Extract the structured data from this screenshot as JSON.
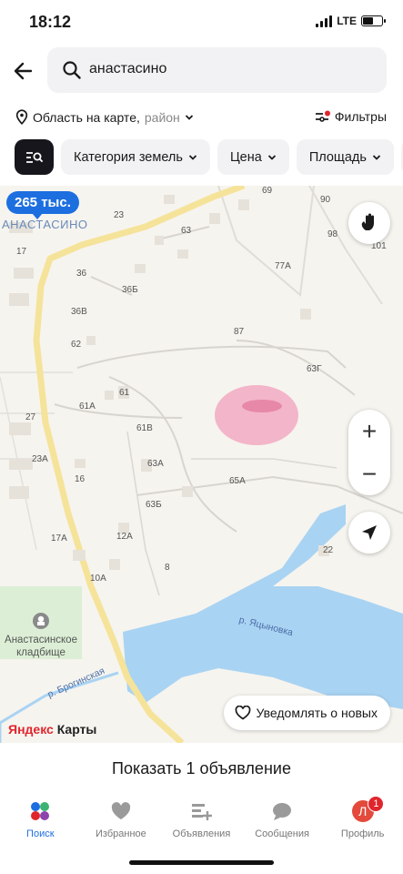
{
  "status": {
    "time": "18:12",
    "network": "LTE",
    "battery_level": 0.55
  },
  "search": {
    "query": "анастасино"
  },
  "location_filter": {
    "label": "Область на карте,",
    "sub": "район"
  },
  "filters_label": "Фильтры",
  "chips": [
    {
      "label": "Категория земель"
    },
    {
      "label": "Цена"
    },
    {
      "label": "Площадь"
    }
  ],
  "map": {
    "price_pin": "265 тыс.",
    "village": "АНАСТАСИНО",
    "house_numbers": [
      "69",
      "90",
      "23",
      "63",
      "98",
      "101",
      "17",
      "77А",
      "36",
      "36Б",
      "36В",
      "87",
      "62",
      "63Г",
      "61",
      "61А",
      "27",
      "61В",
      "63А",
      "23А",
      "16",
      "65А",
      "63Б",
      "17А",
      "12А",
      "22",
      "8",
      "10А"
    ],
    "cemetery": "Анастасинское кладбище",
    "river": "р. Яцыновка",
    "stream": "р. Брогинская",
    "notify_label": "Уведомлять о новых",
    "provider": {
      "part1": "Яндекс",
      "part2": "Карты"
    }
  },
  "show_button": "Показать 1 объявление",
  "tabs": [
    {
      "label": "Поиск",
      "icon": "search-dots-icon",
      "active": true
    },
    {
      "label": "Избранное",
      "icon": "heart-icon",
      "active": false
    },
    {
      "label": "Объявления",
      "icon": "listing-add-icon",
      "active": false
    },
    {
      "label": "Сообщения",
      "icon": "chat-icon",
      "active": false
    },
    {
      "label": "Профиль",
      "icon": "avatar-icon",
      "active": false,
      "avatar_letter": "Л",
      "badge": "1"
    }
  ],
  "colors": {
    "accent": "#1d6fe0",
    "water": "#a9d3f2",
    "road": "#f5e39a",
    "highlight": "#f2a5bf"
  }
}
